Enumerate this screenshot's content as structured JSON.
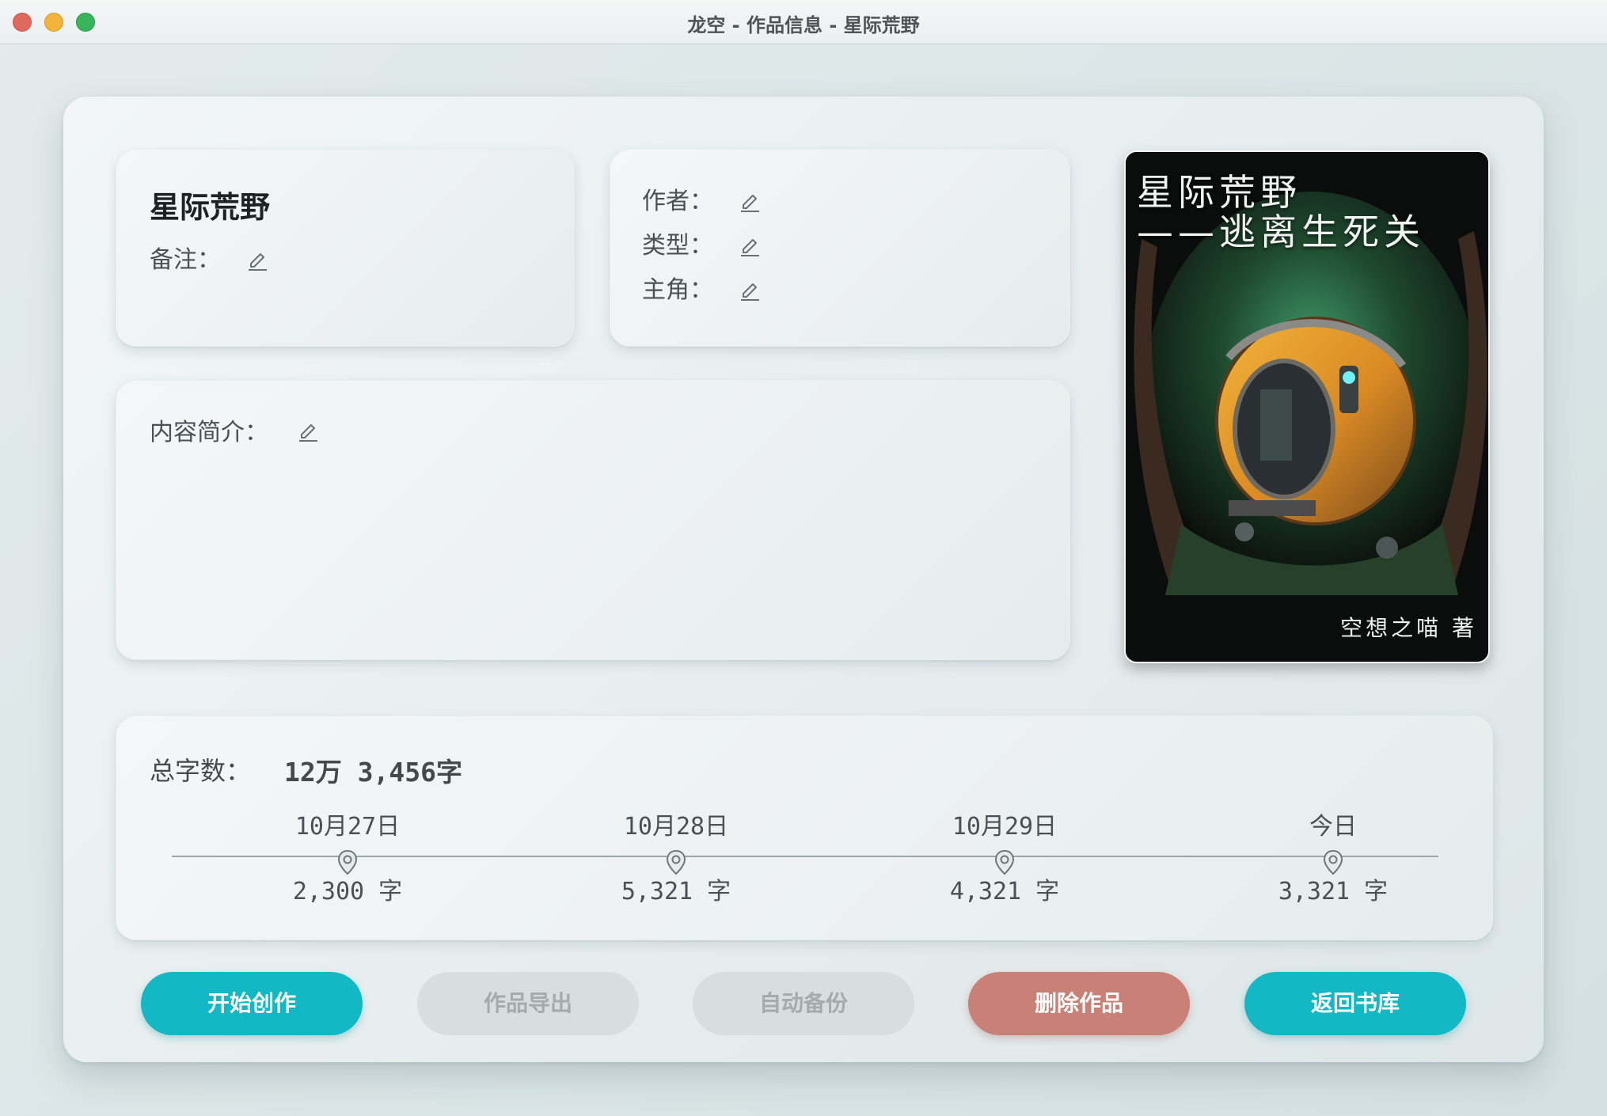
{
  "window": {
    "title": "龙空 - 作品信息 - 星际荒野"
  },
  "work": {
    "title": "星际荒野",
    "note_label": "备注：",
    "author_label": "作者：",
    "genre_label": "类型：",
    "protagonist_label": "主角：",
    "synopsis_label": "内容简介："
  },
  "cover": {
    "title_line1": "星际荒野",
    "title_line2": "——逃离生死关",
    "author": "空想之喵 著"
  },
  "stats": {
    "total_label": "总字数：",
    "total_value": "12万 3,456字",
    "timeline": [
      {
        "date": "10月27日",
        "count": "2,300 字"
      },
      {
        "date": "10月28日",
        "count": "5,321 字"
      },
      {
        "date": "10月29日",
        "count": "4,321 字"
      },
      {
        "date": "今日",
        "count": "3,321 字"
      }
    ]
  },
  "buttons": {
    "start": "开始创作",
    "export": "作品导出",
    "backup": "自动备份",
    "delete": "删除作品",
    "back": "返回书库"
  },
  "colors": {
    "accent": "#12b8c4",
    "danger": "#c98077",
    "disabled": "#d6dedf"
  },
  "icons": {
    "edit": "pencil-icon",
    "timeline_marker": "location-pin-icon"
  }
}
